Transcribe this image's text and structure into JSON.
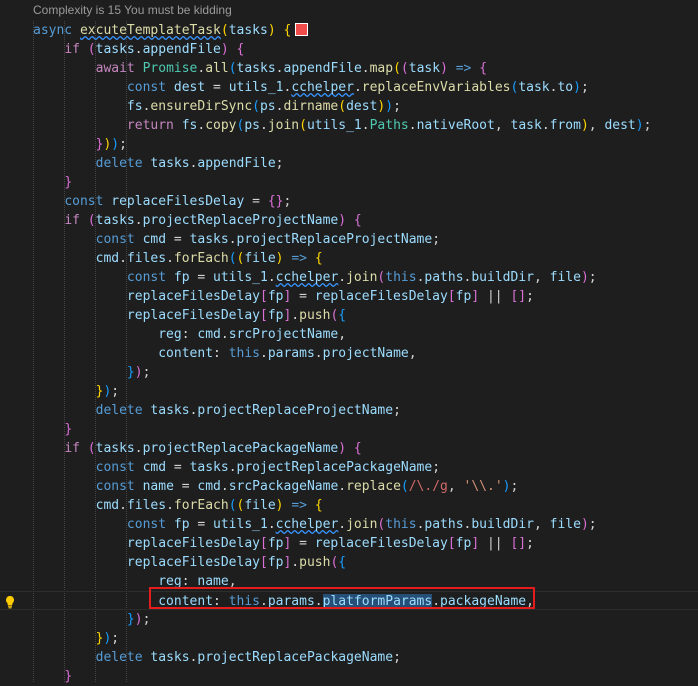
{
  "codelens": "Complexity is 15 You must be kidding",
  "line1": {
    "async": "async",
    "fname": "excuteTemplateTask",
    "open": "(",
    "param": "tasks",
    "close": ")",
    "brace": " {"
  },
  "t": {
    "if": "if",
    "await": "await",
    "const": "const",
    "return": "return",
    "delete": "delete",
    "this": "this",
    "tasks": "tasks",
    "appendFile": "appendFile",
    "Promise": "Promise",
    "all": "all",
    "map": "map",
    "task": "task",
    "dest": "dest",
    "utils_1": "utils_1",
    "cchelper": "cchelper",
    "replaceEnvVariables": "replaceEnvVariables",
    "to": "to",
    "fs": "fs",
    "ensureDirSync": "ensureDirSync",
    "ps": "ps",
    "dirname": "dirname",
    "copy": "copy",
    "join": "join",
    "Paths": "Paths",
    "nativeRoot": "nativeRoot",
    "from": "from",
    "replaceFilesDelay": "replaceFilesDelay",
    "projectReplaceProjectName": "projectReplaceProjectName",
    "cmd": "cmd",
    "files": "files",
    "forEach": "forEach",
    "file": "file",
    "fp": "fp",
    "paths": "paths",
    "buildDir": "buildDir",
    "push": "push",
    "reg": "reg",
    "srcProjectName": "srcProjectName",
    "content": "content",
    "params": "params",
    "projectName": "projectName",
    "projectReplacePackageName": "projectReplacePackageName",
    "name": "name",
    "srcPackageName": "srcPackageName",
    "replace": "replace",
    "regex": "/\\./g",
    "replStr": "'\\\\.'",
    "platformParams": "platformParams",
    "packageName": "packageName",
    "arrow": "=>",
    "eq": "=",
    "or": "||",
    "emptyObj": "{}",
    "emptyArr": "[]",
    "dot": ".",
    "comma": ",",
    "colon": ":",
    "semi": ";",
    "lp": "(",
    "rp": ")",
    "lb": "{",
    "rb": "}",
    "lsq": "[",
    "rsq": "]"
  }
}
